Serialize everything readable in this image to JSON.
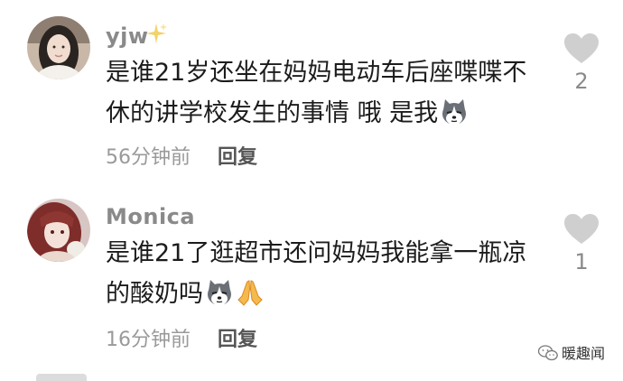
{
  "comments": [
    {
      "username": "yjw",
      "text": "是谁21岁还坐在妈妈电动车后座喋喋不休的讲学校发生的事情 哦 是我",
      "time": "56分钟前",
      "reply_label": "回复",
      "likes": "2",
      "avatar_icon": "girl-avatar",
      "emojis": [
        "husky-emoji"
      ]
    },
    {
      "username": "Monica",
      "text": "是谁21了逛超市还问妈妈我能拿一瓶凉的酸奶吗",
      "time": "16分钟前",
      "reply_label": "回复",
      "likes": "1",
      "avatar_icon": "anime-avatar",
      "emojis": [
        "husky-emoji",
        "pray-emoji"
      ]
    }
  ],
  "watermark": {
    "label": "暖趣闻",
    "icon": "wechat-icon"
  },
  "colors": {
    "username": "#8a8a8a",
    "body_text": "#1c1c1c",
    "meta": "#9a9a9a",
    "heart": "#cfcfcf"
  }
}
